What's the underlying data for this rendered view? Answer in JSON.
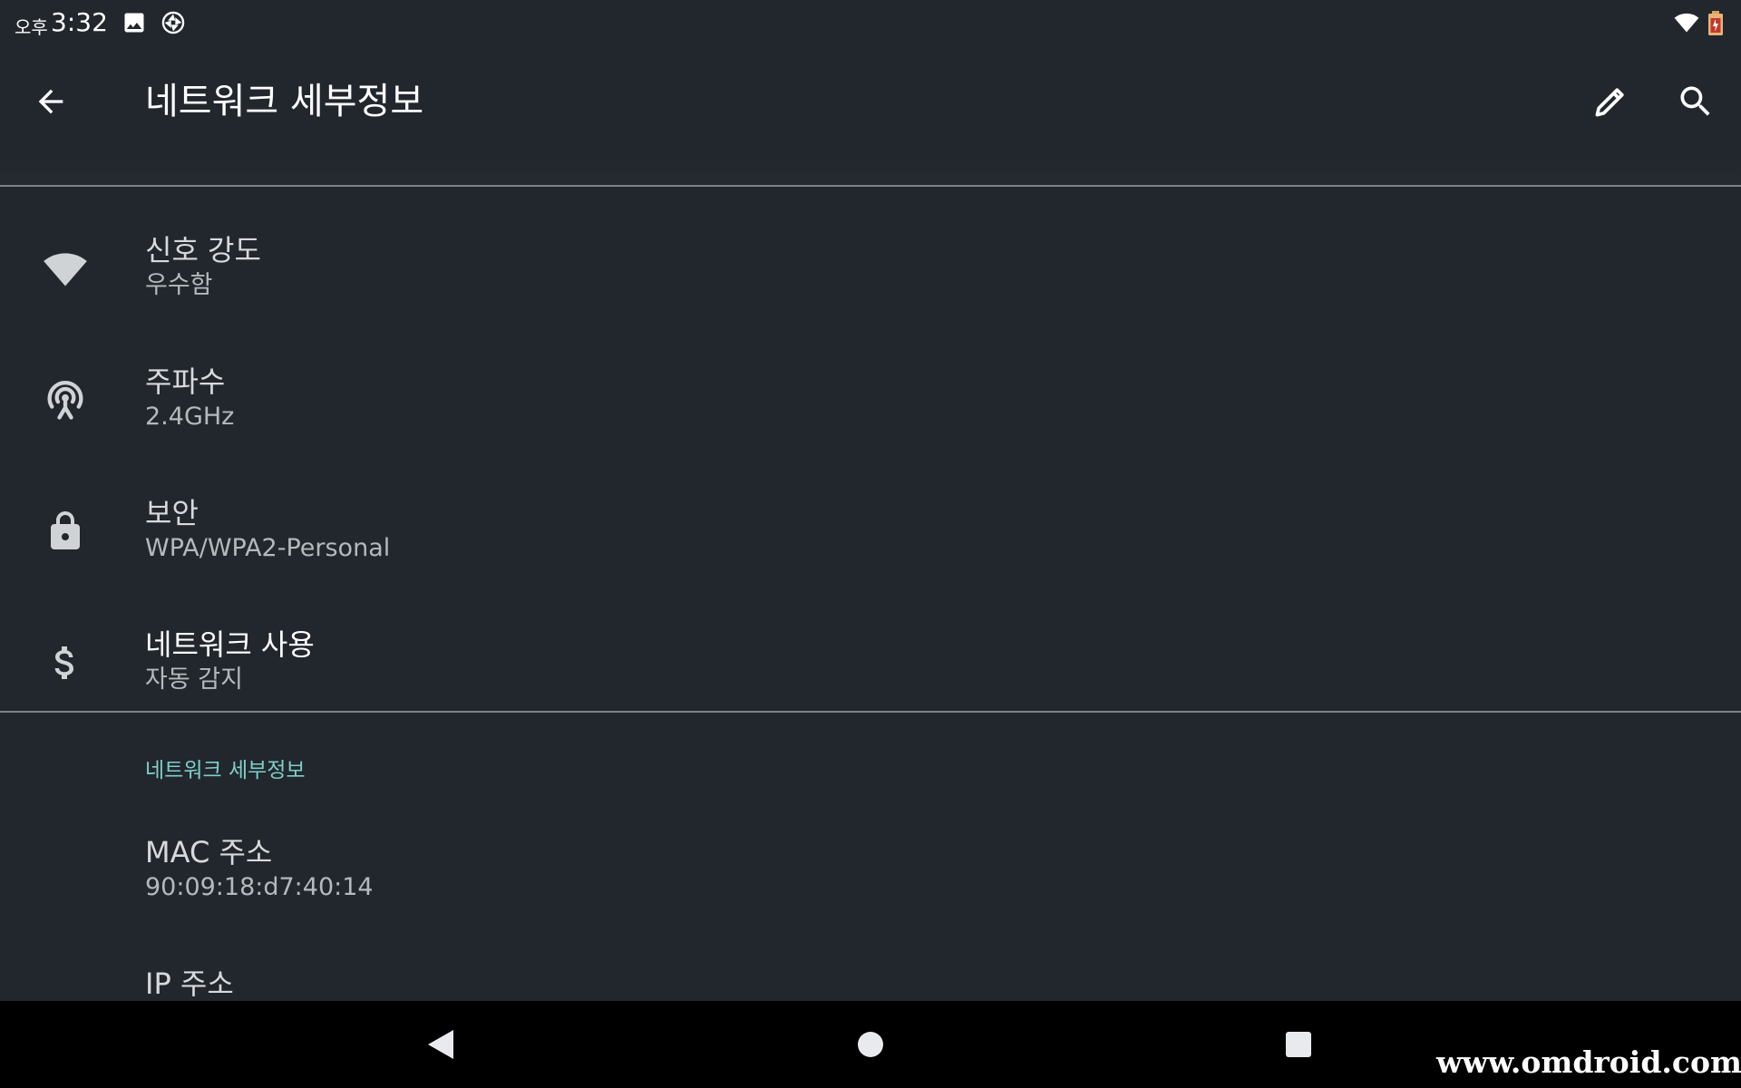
{
  "status_bar": {
    "ampm": "오후",
    "time": "3:32",
    "icons": [
      "image-icon",
      "aperture-icon",
      "wifi-icon",
      "battery-charging-icon"
    ]
  },
  "app_bar": {
    "title": "네트워크 세부정보",
    "back_icon": "back-arrow-icon",
    "edit_icon": "pencil-icon",
    "search_icon": "search-icon"
  },
  "rows": [
    {
      "icon": "wifi-signal-icon",
      "title": "신호 강도",
      "subtitle": "우수함"
    },
    {
      "icon": "frequency-antenna-icon",
      "title": "주파수",
      "subtitle": "2.4GHz"
    },
    {
      "icon": "lock-icon",
      "title": "보안",
      "subtitle": "WPA/WPA2-Personal"
    },
    {
      "icon": "dollar-icon",
      "title": "네트워크 사용",
      "subtitle": "자동 감지"
    }
  ],
  "details_section": {
    "header": "네트워크 세부정보",
    "items": [
      {
        "title": "MAC 주소",
        "subtitle": "90:09:18:d7:40:14"
      },
      {
        "title": "IP 주소",
        "subtitle": ""
      }
    ]
  },
  "nav_bar": {
    "back": "nav-back-icon",
    "home": "nav-home-icon",
    "recents": "nav-recents-icon"
  },
  "watermark": "www.omdroid.com",
  "colors": {
    "background": "#22272d",
    "accent": "#7fcfc9",
    "nav_background": "#000000",
    "icon": "#d0d3d6"
  }
}
